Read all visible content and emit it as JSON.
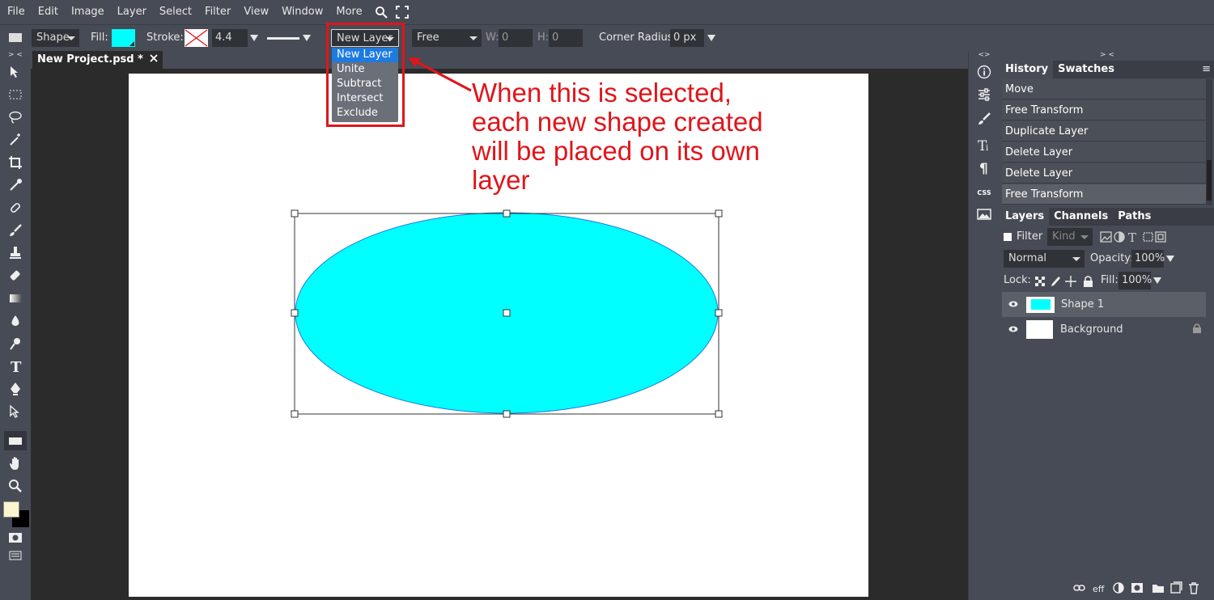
{
  "menubar": {
    "items": [
      "File",
      "Edit",
      "Image",
      "Layer",
      "Select",
      "Filter",
      "View",
      "Window",
      "More"
    ],
    "icons": [
      "search-icon",
      "fullscreen-icon"
    ]
  },
  "options": {
    "shape_mode": "Shape",
    "fill_label": "Fill:",
    "fill_color": "#00ffff",
    "stroke_label": "Stroke:",
    "stroke_width": "4.4 px",
    "combine_mode": "New Layer",
    "constraint": "Free",
    "w_label": "W:",
    "w_value": "0",
    "h_label": "H:",
    "h_value": "0",
    "corner_label": "Corner Radius:",
    "corner_value": "0 px"
  },
  "dropdown": {
    "options": [
      "New Layer",
      "Unite",
      "Subtract",
      "Intersect",
      "Exclude"
    ],
    "selected": "New Layer"
  },
  "annotation": {
    "lines": [
      "When this is selected,",
      "each new shape created",
      "will be placed on its own",
      "layer"
    ],
    "color": "#e0151b"
  },
  "document": {
    "tab_title": "New Project.psd *",
    "shape_color": "#00ffff"
  },
  "panel_top": {
    "tabs": [
      "History",
      "Swatches"
    ],
    "history": [
      "Move",
      "Free Transform",
      "Duplicate Layer",
      "Delete Layer",
      "Delete Layer",
      "Free Transform"
    ]
  },
  "layers_panel": {
    "tabs": [
      "Layers",
      "Channels",
      "Paths"
    ],
    "filter_label": "Filter",
    "kind_label": "Kind",
    "blend_mode": "Normal",
    "opacity_label": "Opacity:",
    "opacity_value": "100%",
    "lock_label": "Lock:",
    "fill_label": "Fill:",
    "fill_value": "100%",
    "layers": [
      {
        "name": "Shape 1",
        "selected": true
      },
      {
        "name": "Background",
        "locked": true
      }
    ]
  },
  "strips": {
    "left_collapse": "> <",
    "right_collapse": "<>",
    "panel_collapse": "> <",
    "css_label": "CSS"
  }
}
